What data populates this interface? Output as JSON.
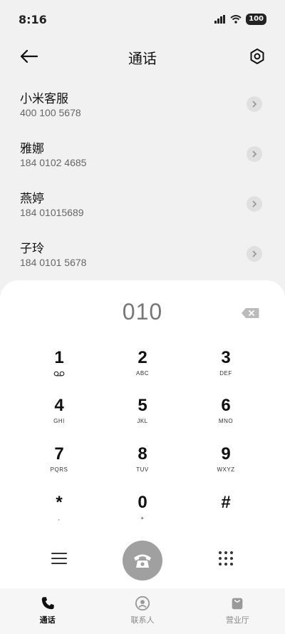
{
  "status_bar": {
    "time": "8:16",
    "battery": "100"
  },
  "header": {
    "title": "通话"
  },
  "contacts": [
    {
      "name": "小米客服",
      "number": "400 100 5678"
    },
    {
      "name": "雅娜",
      "number": "184 0102 4685"
    },
    {
      "name": "燕婷",
      "number": "184 01015689"
    },
    {
      "name": "子玲",
      "number": "184 0101 5678"
    }
  ],
  "dialpad": {
    "display": "010",
    "keys": [
      {
        "digit": "1",
        "letters": ""
      },
      {
        "digit": "2",
        "letters": "ABC"
      },
      {
        "digit": "3",
        "letters": "DEF"
      },
      {
        "digit": "4",
        "letters": "GHI"
      },
      {
        "digit": "5",
        "letters": "JKL"
      },
      {
        "digit": "6",
        "letters": "MNO"
      },
      {
        "digit": "7",
        "letters": "PQRS"
      },
      {
        "digit": "8",
        "letters": "TUV"
      },
      {
        "digit": "9",
        "letters": "WXYZ"
      },
      {
        "digit": "*",
        "letters": ","
      },
      {
        "digit": "0",
        "letters": "+"
      },
      {
        "digit": "#",
        "letters": ""
      }
    ]
  },
  "tabs": [
    {
      "label": "通话",
      "icon": "phone-icon",
      "active": true
    },
    {
      "label": "联系人",
      "icon": "contacts-icon",
      "active": false
    },
    {
      "label": "营业厅",
      "icon": "store-bag-icon",
      "active": false
    }
  ],
  "colors": {
    "background": "#f1f1f1",
    "panel": "#ffffff",
    "call_button": "#a0a0a0",
    "chevron_bg": "#e0e0e0"
  }
}
